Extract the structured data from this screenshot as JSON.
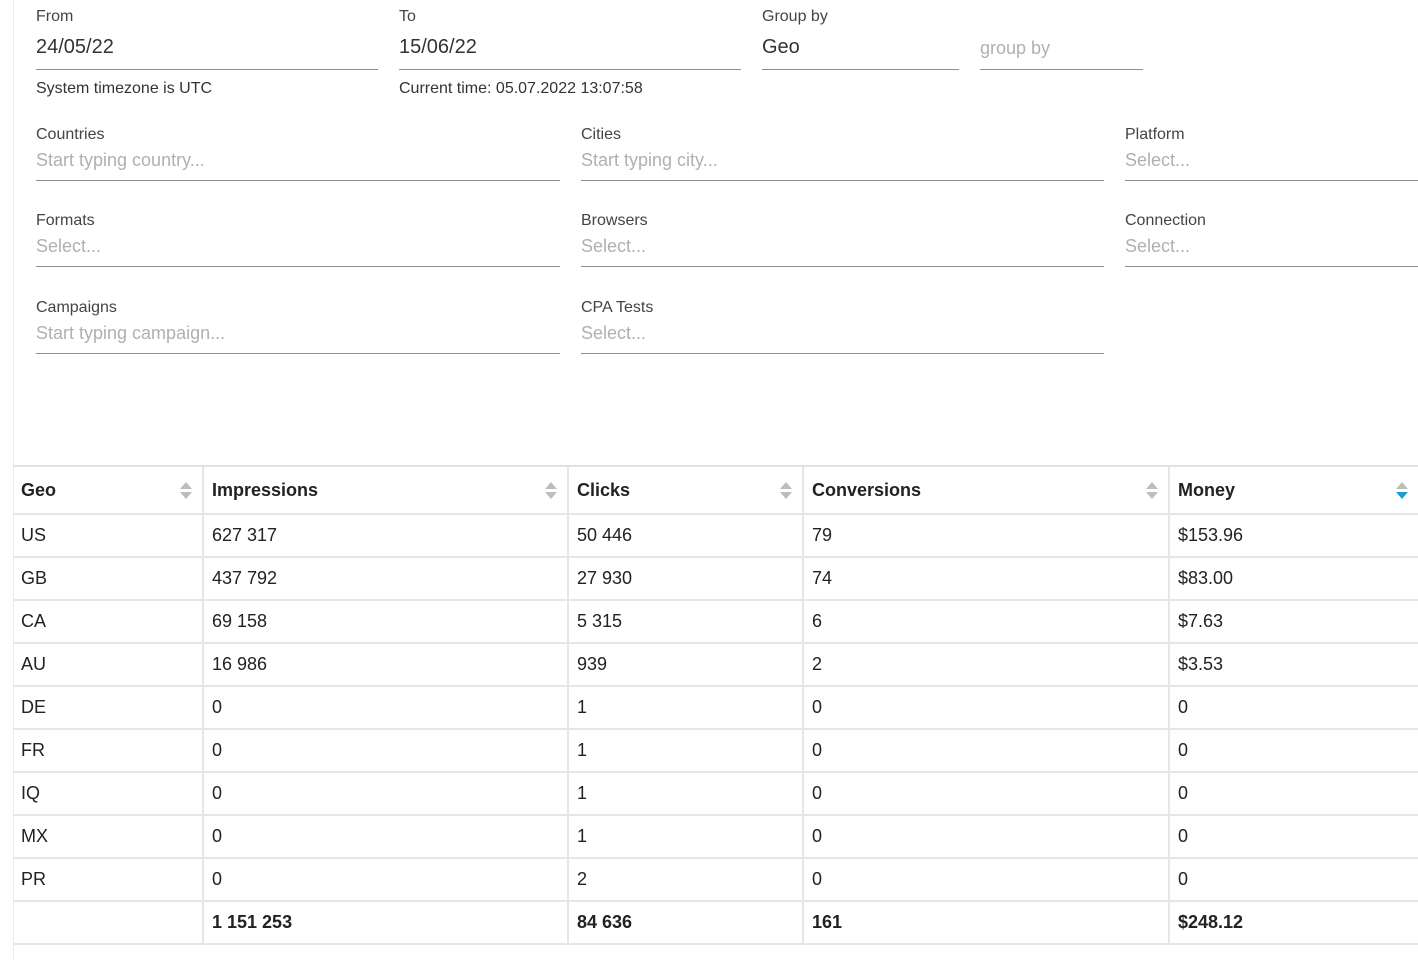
{
  "date_range": {
    "from": {
      "label": "From",
      "value": "24/05/22",
      "helper": "System timezone is UTC"
    },
    "to": {
      "label": "To",
      "value": "15/06/22",
      "helper": "Current time: 05.07.2022 13:07:58"
    }
  },
  "group_by": {
    "label": "Group by",
    "value": "Geo",
    "second_placeholder": "group by"
  },
  "filters": {
    "countries": {
      "label": "Countries",
      "placeholder": "Start typing country..."
    },
    "cities": {
      "label": "Cities",
      "placeholder": "Start typing city..."
    },
    "platform": {
      "label": "Platform",
      "placeholder": "Select..."
    },
    "formats": {
      "label": "Formats",
      "placeholder": "Select..."
    },
    "browsers": {
      "label": "Browsers",
      "placeholder": "Select..."
    },
    "connection": {
      "label": "Connection",
      "placeholder": "Select..."
    },
    "campaigns": {
      "label": "Campaigns",
      "placeholder": "Start typing campaign..."
    },
    "cpa_tests": {
      "label": "CPA Tests",
      "placeholder": "Select..."
    }
  },
  "table": {
    "columns": [
      "Geo",
      "Impressions",
      "Clicks",
      "Conversions",
      "Money"
    ],
    "sort": {
      "column": "Money",
      "direction": "desc",
      "active_color": "#1e9bd7"
    },
    "rows": [
      [
        "US",
        "627 317",
        "50 446",
        "79",
        "$153.96"
      ],
      [
        "GB",
        "437 792",
        "27 930",
        "74",
        "$83.00"
      ],
      [
        "CA",
        "69 158",
        "5 315",
        "6",
        "$7.63"
      ],
      [
        "AU",
        "16 986",
        "939",
        "2",
        "$3.53"
      ],
      [
        "DE",
        "0",
        "1",
        "0",
        "0"
      ],
      [
        "FR",
        "0",
        "1",
        "0",
        "0"
      ],
      [
        "IQ",
        "0",
        "1",
        "0",
        "0"
      ],
      [
        "MX",
        "0",
        "1",
        "0",
        "0"
      ],
      [
        "PR",
        "0",
        "2",
        "0",
        "0"
      ]
    ],
    "totals": [
      "",
      "1 151 253",
      "84 636",
      "161",
      "$248.12"
    ]
  }
}
